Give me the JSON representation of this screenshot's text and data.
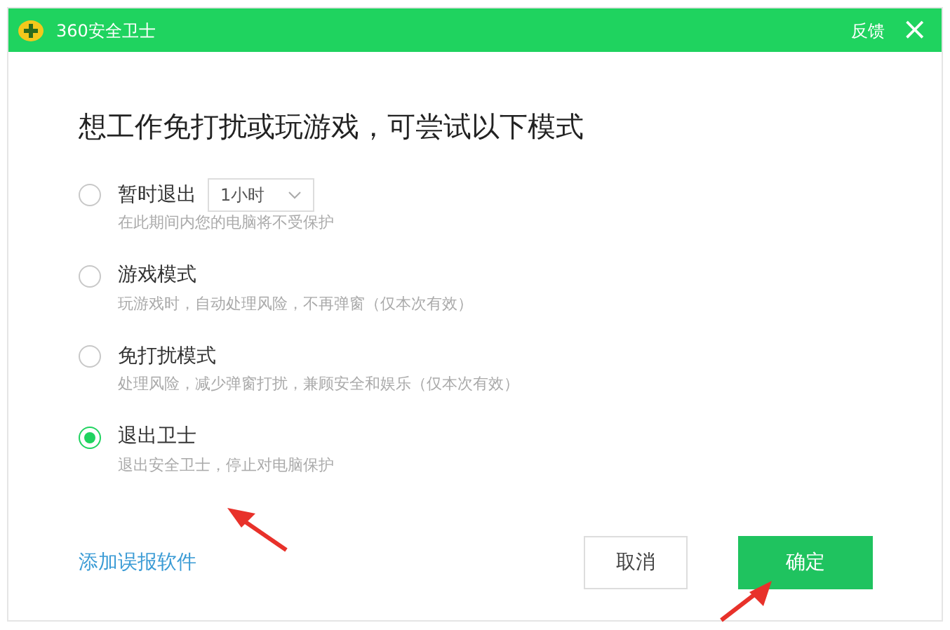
{
  "window": {
    "title": "360安全卫士",
    "feedback": "反馈",
    "close": "×"
  },
  "heading": "想工作免打扰或玩游戏，可尝试以下模式",
  "options": [
    {
      "label": "暂时退出",
      "description": "在此期间内您的电脑将不受保护",
      "selected": false,
      "dropdown": "1小时"
    },
    {
      "label": "游戏模式",
      "description": "玩游戏时，自动处理风险，不再弹窗（仅本次有效）",
      "selected": false
    },
    {
      "label": "免打扰模式",
      "description": "处理风险，减少弹窗打扰，兼顾安全和娱乐（仅本次有效）",
      "selected": false
    },
    {
      "label": "退出卫士",
      "description": "退出安全卫士，停止对电脑保护",
      "selected": true
    }
  ],
  "link": "添加误报软件",
  "buttons": [
    {
      "label": "取消",
      "kind": "secondary"
    },
    {
      "label": "确定",
      "kind": "primary"
    }
  ]
}
